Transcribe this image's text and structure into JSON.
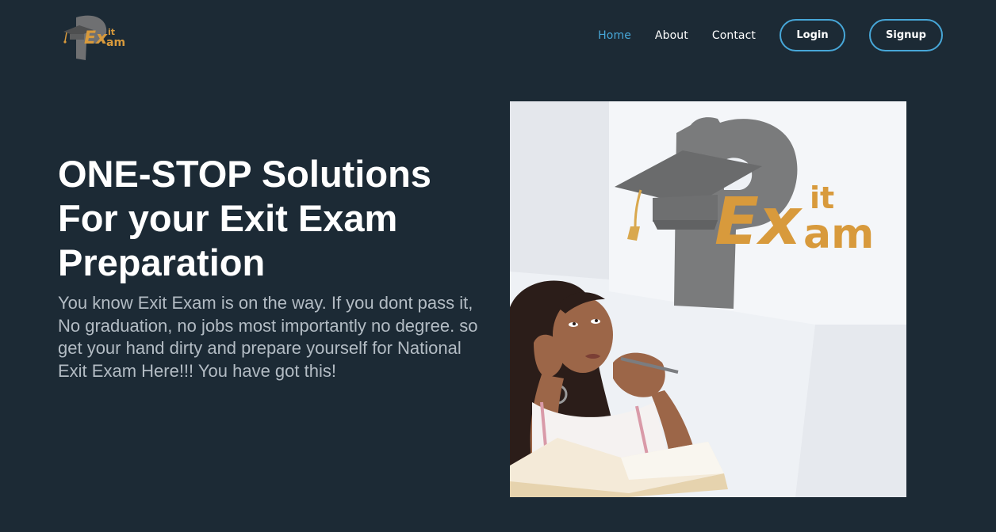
{
  "header": {
    "logo": {
      "text_main": "Ex",
      "text_sup": "it",
      "text_sub": "am",
      "icon": "graduation-cap-p-logo"
    },
    "nav": [
      {
        "label": "Home",
        "active": true
      },
      {
        "label": "About",
        "active": false
      },
      {
        "label": "Contact",
        "active": false
      }
    ],
    "login_label": "Login",
    "signup_label": "Signup"
  },
  "hero": {
    "title": "ONE-STOP Solutions For your Exit Exam Preparation",
    "description": "You know Exit Exam is on the way. If you dont pass it, No graduation, no jobs most importantly no degree. so get your hand dirty and prepare yourself for National Exit Exam Here!!! You have got this!",
    "image": {
      "logo_main": "Ex",
      "logo_sup": "it",
      "logo_sub": "am",
      "icon": "student-thinking-illustration"
    }
  },
  "colors": {
    "background": "#1c2a35",
    "accent": "#47a7d8",
    "logo_gold": "#d89a3c",
    "logo_gray": "#7a7b7c",
    "text_muted": "#b3bcc4"
  }
}
